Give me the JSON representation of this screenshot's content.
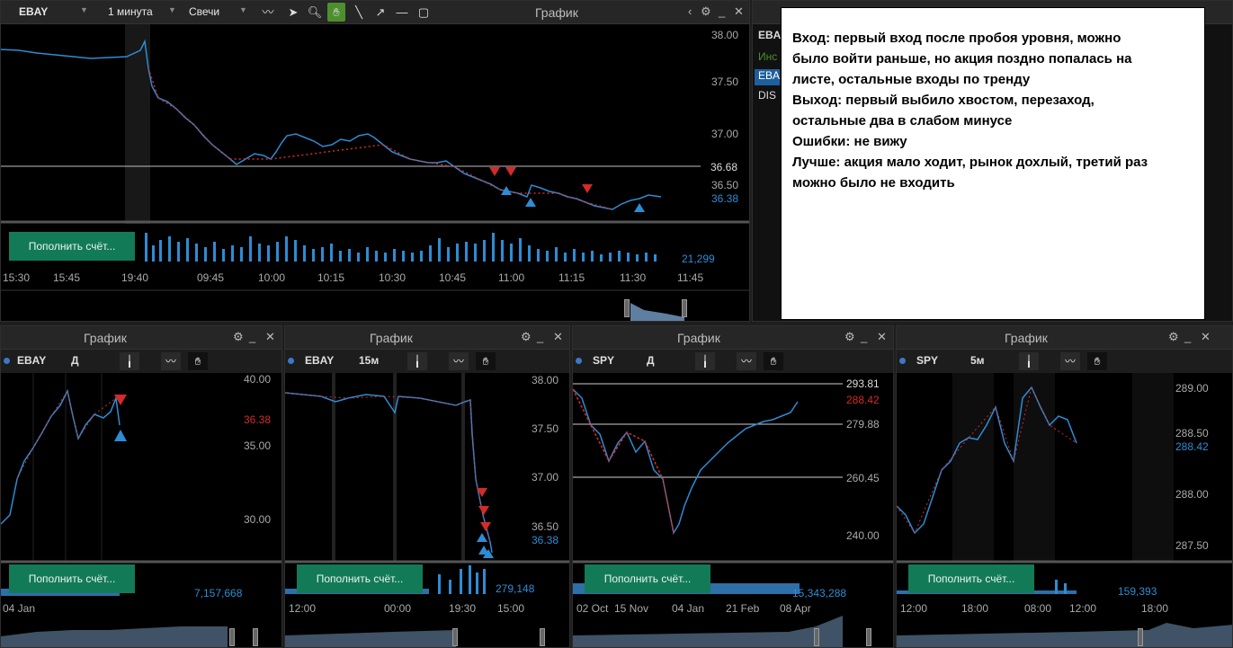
{
  "main": {
    "ticker": "EBAY",
    "interval": "1 минута",
    "chart_type": "Свечи",
    "title": "График",
    "prices": [
      "38.00",
      "37.50",
      "37.00",
      "36.68",
      "36.50",
      "36.38"
    ],
    "times": [
      "15:30",
      "15:45",
      "19:40",
      "09:45",
      "10:00",
      "10:15",
      "10:30",
      "10:45",
      "11:00",
      "11:15",
      "11:30",
      "11:45"
    ],
    "deposit": "Пополнить счёт...",
    "volume": "21,299"
  },
  "side": {
    "ticker": "EBA",
    "label": "Инс",
    "row1": "EBA",
    "row2": "DIS"
  },
  "note": {
    "lines": [
      "Вход: первый вход после пробоя уровня, можно",
      "было войти раньше, но акция поздно попалась на",
      "листе, остальные входы по тренду",
      "Выход: первый выбило хвостом, перезаход,",
      "остальные два в слабом минусе",
      "Ошибки: не вижу",
      "Лучше: акция мало ходит, рынок дохлый, третий раз",
      "можно было не входить"
    ]
  },
  "charts": [
    {
      "title": "График",
      "ticker": "EBAY",
      "interval": "Д",
      "prices": [
        "40.00",
        "36.38",
        "35.00",
        "30.00"
      ],
      "times": [
        "04 Jan"
      ],
      "deposit": "Пополнить счёт...",
      "volume": "7,157,668"
    },
    {
      "title": "График",
      "ticker": "EBAY",
      "interval": "15м",
      "prices": [
        "38.00",
        "37.50",
        "37.00",
        "36.50",
        "36.38"
      ],
      "times": [
        "12:00",
        "00:00",
        "19:30",
        "15:00"
      ],
      "deposit": "Пополнить счёт...",
      "volume": "279,148"
    },
    {
      "title": "График",
      "ticker": "SPY",
      "interval": "Д",
      "prices": [
        "293.81",
        "288.42",
        "279.88",
        "260.45",
        "240.00"
      ],
      "times": [
        "02 Oct",
        "15 Nov",
        "04 Jan",
        "21 Feb",
        "08 Apr"
      ],
      "deposit": "Пополнить счёт...",
      "volume": "15,343,288"
    },
    {
      "title": "График",
      "ticker": "SPY",
      "interval": "5м",
      "prices": [
        "289.00",
        "288.50",
        "288.42",
        "288.00",
        "287.50"
      ],
      "times": [
        "12:00",
        "18:00",
        "08:00",
        "12:00",
        "18:00"
      ],
      "deposit": "Пополнить счёт...",
      "volume": "159,393"
    }
  ],
  "colors": {
    "up": "#2e8cd4",
    "down": "#d42a2a",
    "accent": "#4d8f2d",
    "deposit": "#137a58"
  }
}
